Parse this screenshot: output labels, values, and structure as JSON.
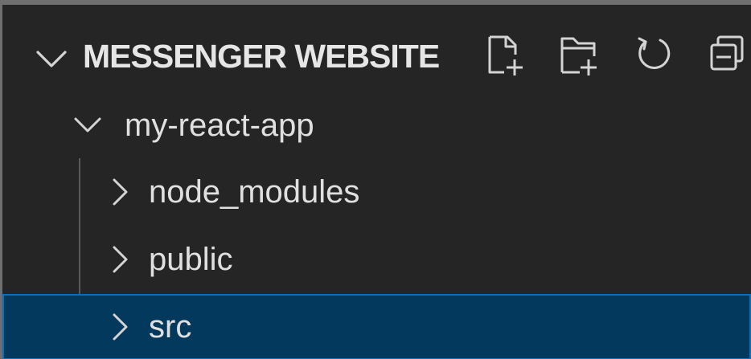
{
  "explorer": {
    "section_title": "MESSENGER WEBSITE",
    "actions": {
      "new_file": "new-file-icon",
      "new_folder": "new-folder-icon",
      "refresh": "refresh-icon",
      "collapse_all": "collapse-all-icon"
    },
    "tree": [
      {
        "label": "my-react-app",
        "expanded": true,
        "level": 1
      },
      {
        "label": "node_modules",
        "expanded": false,
        "level": 2
      },
      {
        "label": "public",
        "expanded": false,
        "level": 2
      },
      {
        "label": "src",
        "expanded": false,
        "level": 2,
        "selected": true
      }
    ]
  },
  "colors": {
    "background": "#252526",
    "text": "#e0e0e0",
    "selection_bg": "#04395e",
    "selection_border": "#0a6fb8",
    "indent_guide": "#585858"
  }
}
